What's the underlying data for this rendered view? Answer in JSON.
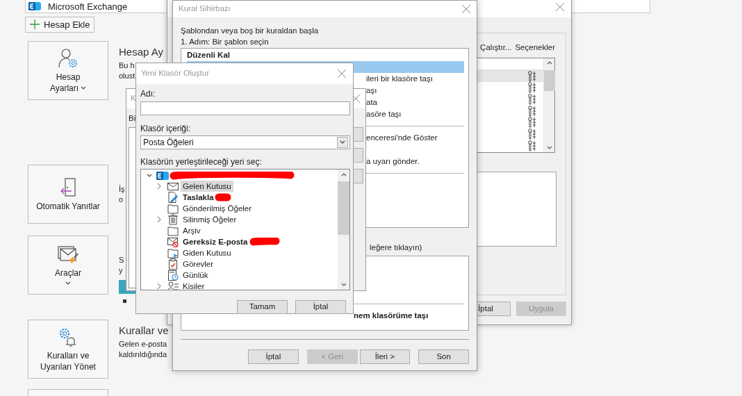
{
  "backstage": {
    "account": "Microsoft Exchange",
    "add_account_button": "Hesap Ekle",
    "tiles": [
      {
        "kind": "account",
        "label": "Hesap Ayarları",
        "dropdown": true
      },
      {
        "kind": "auto-reply",
        "label": "Otomatik Yanıtlar",
        "dropdown": false
      },
      {
        "kind": "tools",
        "label": "Araçlar",
        "dropdown": true
      },
      {
        "kind": "rules",
        "label": "Kuralları ve Uyarıları Yönet",
        "dropdown": false
      }
    ],
    "sections": [
      {
        "heading": "Hesap Ay",
        "lines": [
          "Bu h",
          "olust"
        ],
        "storage_bar": false
      },
      {
        "lines": [
          "İş",
          "o"
        ],
        "storage_bar": false
      },
      {
        "lines": [
          "S",
          "y"
        ],
        "storage_bar": true
      },
      {
        "heading": "Kurallar ve",
        "lines": [
          "Gelen e-posta",
          "kaldırıldığında"
        ],
        "storage_bar": false
      }
    ]
  },
  "rules_window": {
    "toolbar": [
      "Çalıştır...",
      "Seçenekler"
    ],
    "rows": [
      {
        "selected": true
      },
      {
        "selected": false
      },
      {
        "selected": false
      },
      {
        "selected": false
      },
      {
        "selected": false
      },
      {
        "selected": false
      },
      {
        "selected": false
      }
    ],
    "buttons": [
      {
        "label": "İptal",
        "disabled": false
      },
      {
        "label": "Uygula",
        "disabled": true
      }
    ]
  },
  "wizard": {
    "title": "Kural Sihirbazı",
    "intro": "Şablondan veya boş bir kuraldan başla",
    "step": "1. Adım: Bir şablon seçin",
    "templates": [
      {
        "kind": "header",
        "text": "Düzenli Kal"
      },
      {
        "kind": "item",
        "selected": true
      },
      {
        "kind": "item",
        "text": "ileri bir klasöre taşı",
        "selected": false
      },
      {
        "kind": "item",
        "text": "aşı",
        "selected": false
      },
      {
        "kind": "item",
        "text": "ata",
        "selected": false
      },
      {
        "kind": "item",
        "text": "asöre taşı",
        "selected": false
      },
      {
        "kind": "divider"
      },
      {
        "kind": "item",
        "text": "enceresi'nde Göster",
        "selected": false
      },
      {
        "kind": "item",
        "selected": false
      },
      {
        "kind": "item",
        "text": "a uyarı gönder.",
        "selected": false
      },
      {
        "kind": "divider"
      }
    ],
    "step2": "leğere tıklayın)",
    "description": "nem klasörüme taşı",
    "buttons": [
      {
        "label": "İptal",
        "disabled": false
      },
      {
        "label": "< Geri",
        "disabled": true
      },
      {
        "label": "İleri >",
        "disabled": false
      },
      {
        "label": "Son",
        "disabled": false
      }
    ]
  },
  "middle_dialog": {
    "title": "K",
    "label": "Bi"
  },
  "new_folder_dialog": {
    "title": "Yeni Klasör Oluştur",
    "name_label": "Adı:",
    "content_label": "Klasör içeriği:",
    "content_value": "Posta Öğeleri",
    "location_label": "Klasörün yerleştirileceği yeri seç:",
    "tree": {
      "expanded": true,
      "children": [
        {
          "label": "Gelen Kutusu",
          "kind": "inbox",
          "bold": false,
          "expandable": true,
          "selected": true
        },
        {
          "label": "Taslakla",
          "kind": "drafts",
          "bold": true,
          "expandable": false,
          "selected": false
        },
        {
          "label": "Gönderilmiş Öğeler",
          "kind": "folder",
          "bold": false,
          "expandable": false,
          "selected": false
        },
        {
          "label": "Silinmiş Öğeler",
          "kind": "trash",
          "bold": false,
          "expandable": true,
          "selected": false
        },
        {
          "label": "Arşiv",
          "kind": "folder",
          "bold": false,
          "expandable": false,
          "selected": false
        },
        {
          "label": "Gereksiz E-posta",
          "kind": "junk",
          "bold": true,
          "expandable": false,
          "selected": false
        },
        {
          "label": "Giden Kutusu",
          "kind": "outbox",
          "bold": false,
          "expandable": false,
          "selected": false
        },
        {
          "label": "Görevler",
          "kind": "tasks",
          "bold": false,
          "expandable": false,
          "selected": false
        },
        {
          "label": "Günlük",
          "kind": "journal",
          "bold": false,
          "expandable": false,
          "selected": false
        },
        {
          "label": "Kisiler",
          "kind": "contacts",
          "bold": false,
          "expandable": true,
          "selected": false
        }
      ]
    },
    "buttons": [
      "Tamam",
      "İptal"
    ]
  }
}
